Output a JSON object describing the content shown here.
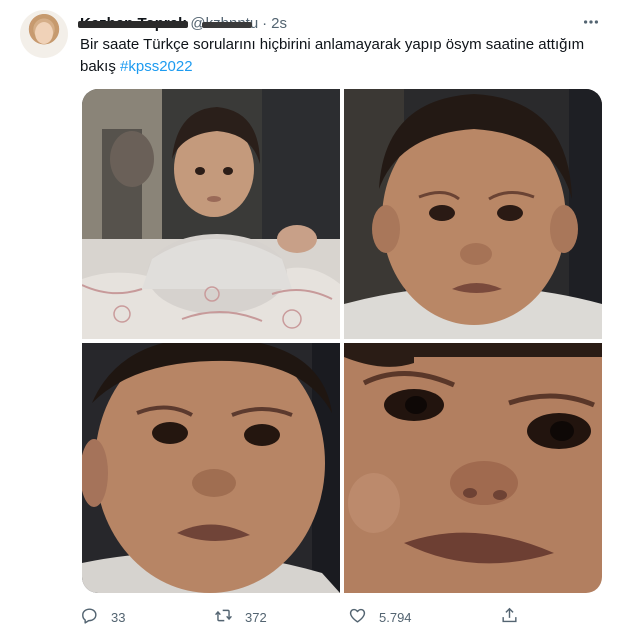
{
  "tweet": {
    "display_name": "Kezban Toprak",
    "handle": "@kzbnntu",
    "separator": "·",
    "time": "2s",
    "more_icon": "ellipsis-icon",
    "text_before": "Bir saate Türkçe sorularını hiçbirini anlamayarak yapıp ösym saatine attığım bakış ",
    "hashtag": "#kpss2022",
    "media": [
      {
        "alt": "toddler sitting at a table"
      },
      {
        "alt": "toddler face close-up"
      },
      {
        "alt": "toddler face closer"
      },
      {
        "alt": "toddler face extreme close-up"
      }
    ],
    "actions": {
      "reply_icon": "reply-icon",
      "reply_count": "33",
      "retweet_icon": "retweet-icon",
      "retweet_count": "372",
      "like_icon": "heart-icon",
      "like_count": "5.794",
      "share_icon": "share-icon"
    }
  },
  "colors": {
    "link": "#1d9bf0",
    "secondary_text": "#536471",
    "primary_text": "#0f1419"
  }
}
